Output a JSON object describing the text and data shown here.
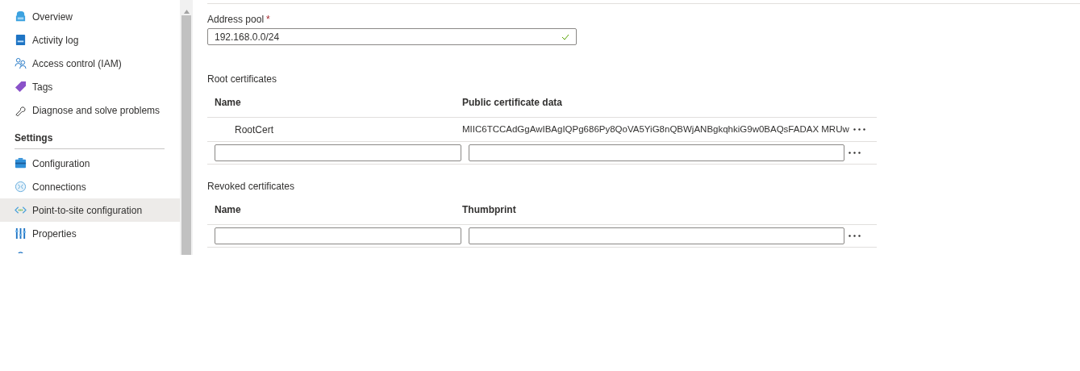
{
  "sidebar": {
    "groups": [
      {
        "items": [
          {
            "label": "Overview",
            "selected": false
          },
          {
            "label": "Activity log",
            "selected": false
          },
          {
            "label": "Access control (IAM)",
            "selected": false
          },
          {
            "label": "Tags",
            "selected": false
          },
          {
            "label": "Diagnose and solve problems",
            "selected": false
          }
        ]
      },
      {
        "header": "Settings",
        "items": [
          {
            "label": "Configuration",
            "selected": false
          },
          {
            "label": "Connections",
            "selected": false
          },
          {
            "label": "Point-to-site configuration",
            "selected": true
          },
          {
            "label": "Properties",
            "selected": false
          }
        ]
      }
    ]
  },
  "address_pool": {
    "label": "Address pool",
    "required_mark": "*",
    "value": "192.168.0.0/24",
    "valid": true
  },
  "sections": [
    {
      "title": "Root certificates",
      "columns": [
        "Name",
        "Public certificate data"
      ],
      "rows": [
        {
          "kind": "data",
          "cells": [
            "RootCert",
            "MIIC6TCCAdGgAwIBAgIQPg686Py8QoVA5YiG8nQBWjANBgkqhkiG9w0BAQsFADAX MRUw"
          ]
        },
        {
          "kind": "input"
        }
      ]
    },
    {
      "title": "Revoked certificates",
      "columns": [
        "Name",
        "Thumbprint"
      ],
      "rows": [
        {
          "kind": "input"
        }
      ]
    }
  ]
}
